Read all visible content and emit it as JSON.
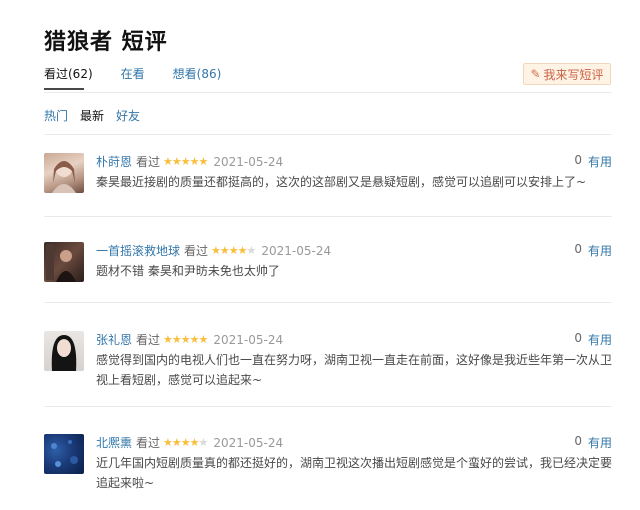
{
  "title": "猎狼者 短评",
  "tabs": [
    {
      "label": "看过(62)"
    },
    {
      "label": "在看"
    },
    {
      "label": "想看(86)"
    }
  ],
  "write_button": {
    "label": "我来写短评",
    "icon": "pencil-icon"
  },
  "filters": [
    {
      "label": "热门"
    },
    {
      "label": "最新"
    },
    {
      "label": "好友"
    }
  ],
  "comments": [
    {
      "user": "朴莳恩",
      "status": "看过",
      "rating": 5,
      "date": "2021-05-24",
      "votes": "0",
      "vote_label": "有用",
      "text": "秦昊最近接剧的质量还都挺高的，这次的这部剧又是悬疑短剧，感觉可以追剧可以安排上了~"
    },
    {
      "user": "一首摇滚救地球",
      "status": "看过",
      "rating": 4,
      "date": "2021-05-24",
      "votes": "0",
      "vote_label": "有用",
      "text": "题材不错 秦昊和尹昉未免也太帅了"
    },
    {
      "user": "张礼恩",
      "status": "看过",
      "rating": 5,
      "date": "2021-05-24",
      "votes": "0",
      "vote_label": "有用",
      "text": "感觉得到国内的电视人们也一直在努力呀，湖南卫视一直走在前面，这好像是我近些年第一次从卫视上看短剧，感觉可以追起来~"
    },
    {
      "user": "北熈熏",
      "status": "看过",
      "rating": 4,
      "date": "2021-05-24",
      "votes": "0",
      "vote_label": "有用",
      "text": "近几年国内短剧质量真的都还挺好的，湖南卫视这次播出短剧感觉是个蛮好的尝试，我已经决定要追起来啦~"
    }
  ],
  "colors": {
    "link": "#3377aa",
    "star": "#f8bf3e",
    "button_bg": "#fff3e6",
    "button_text": "#ca6445"
  }
}
